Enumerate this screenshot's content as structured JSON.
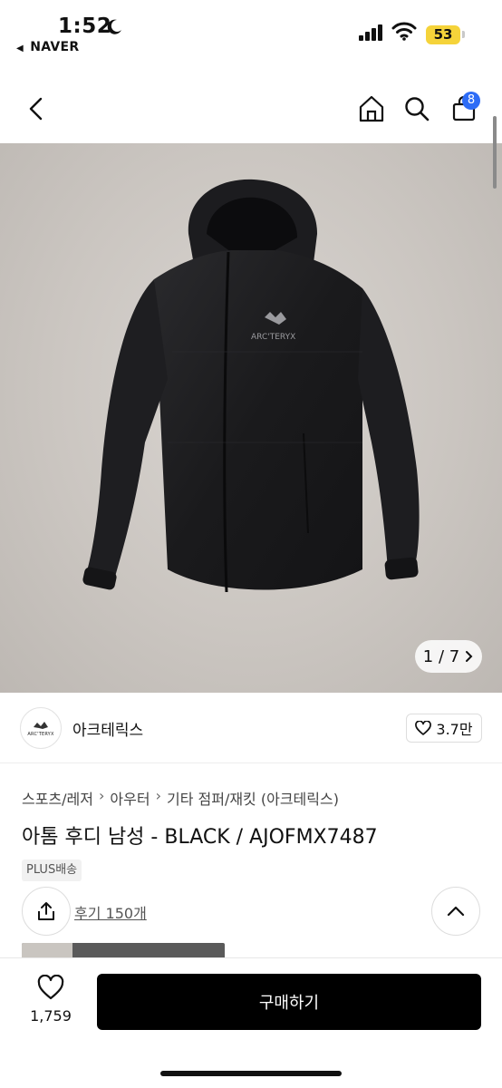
{
  "status_bar": {
    "time": "1:52",
    "back_app": "NAVER",
    "battery": "53"
  },
  "nav": {
    "cart_count": "8"
  },
  "gallery": {
    "pager": "1 / 7",
    "logo_text": "ARC'TERYX"
  },
  "brand": {
    "logo_text": "ARC'TERYX",
    "name": "아크테릭스",
    "likes": "3.7만"
  },
  "breadcrumb": [
    "스포츠/레저",
    "아우터",
    "기타 점퍼/재킷 (아크테릭스)"
  ],
  "product": {
    "title": "아톰 후디 남성 - BLACK / AJOFMX7487",
    "shipping_badge": "PLUS배송",
    "reviews": "후기 150개"
  },
  "bottom_bar": {
    "wish_count": "1,759",
    "buy_label": "구매하기"
  },
  "colors": {
    "accent_badge": "#2d6cf6",
    "battery": "#f5d33a",
    "buy_button": "#000000"
  },
  "icons": [
    "moon-icon",
    "signal-icon",
    "wifi-icon",
    "back-icon",
    "home-icon",
    "search-icon",
    "cart-icon",
    "heart-icon",
    "share-icon",
    "chevron-up-icon",
    "chevron-right-icon"
  ]
}
